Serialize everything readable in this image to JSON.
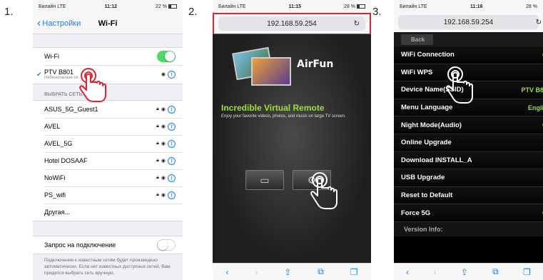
{
  "steps": [
    "1.",
    "2.",
    "3."
  ],
  "phone1": {
    "status": {
      "carrier": "Билайн LTE",
      "time": "11:12",
      "battery": "22 %"
    },
    "nav": {
      "back": "Настройки",
      "title": "Wi-Fi"
    },
    "wifi_label": "Wi-Fi",
    "connected": {
      "name": "PTV B801",
      "sub": "Небезопасная се..."
    },
    "section": "ВЫБРАТЬ СЕТЬ...",
    "networks": [
      "ASUS_5G_Guest1",
      "AVEL",
      "AVEL_5G",
      "Hotel DOSAAF",
      "NoWiFi",
      "PS_wifi"
    ],
    "other": "Другая...",
    "ask_label": "Запрос на подключение",
    "footer": "Подключение к известным сетям будет произведено автоматически. Если нет известных доступных сетей, Вам придется выбрать сеть вручную."
  },
  "phone2": {
    "status": {
      "carrier": "Билайн LTE",
      "time": "11:15",
      "battery": "28 %"
    },
    "url": "192.168.59.254",
    "logo": "AirFun",
    "hero_title": "Incredible Virtual Remote",
    "hero_sub": "Enjoy your favorite videos, photos, and music on large TV screen."
  },
  "phone3": {
    "status": {
      "carrier": "Билайн LTE",
      "time": "11:16",
      "battery": "28 %"
    },
    "url": "192.168.59.254",
    "back": "Back",
    "menu": [
      {
        "label": "WiFi Connection",
        "value": "O"
      },
      {
        "label": "WiFi WPS",
        "value": ""
      },
      {
        "label": "Device Name(SSID)",
        "value": "PTV B80"
      },
      {
        "label": "Menu Language",
        "value": "Englis"
      },
      {
        "label": "Night Mode(Audio)",
        "value": "O"
      },
      {
        "label": "Online Upgrade",
        "value": ""
      },
      {
        "label": "Download INSTALL_A",
        "value": ""
      },
      {
        "label": "USB Upgrade",
        "value": ""
      },
      {
        "label": "Reset to Default",
        "value": ""
      },
      {
        "label": "Force 5G",
        "value": "O"
      }
    ],
    "version": "Version Info:"
  },
  "colors": {
    "ios_blue": "#1a7cf5",
    "toggle_green": "#4cd964",
    "airfun_green": "#9ee02d",
    "highlight_red": "#e0232f"
  }
}
